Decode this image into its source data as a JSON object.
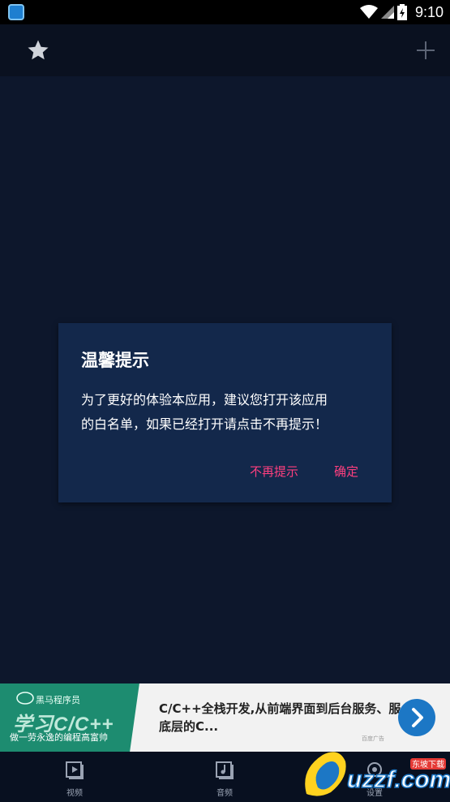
{
  "status_bar": {
    "time": "9:10"
  },
  "dialog": {
    "title": "温馨提示",
    "message_line1": "为了更好的体验本应用，建议您打开该应用",
    "message_line2": "的白名单，如果已经打开请点击不再提示！",
    "dont_remind_label": "不再提示",
    "ok_label": "确定"
  },
  "ad": {
    "brand": "黑马程序员",
    "headline_image_text": "学习C/C++",
    "slogan": "做一劳永逸的编程高富帅",
    "text_line1": "C/C++全栈开发,从前端界面到后台服务、服",
    "text_line2": "底层的C...",
    "tag": "百度广告"
  },
  "bottom_nav": {
    "items": [
      {
        "label": "视频",
        "icon": "video-icon"
      },
      {
        "label": "音频",
        "icon": "audio-icon"
      },
      {
        "label": "设置",
        "icon": "settings-icon"
      }
    ]
  },
  "watermark": {
    "brand": "uzzf.com",
    "caption": "东坡下载"
  },
  "colors": {
    "background": "#0d172c",
    "dialog": "#13284b",
    "accent": "#ff3f7f",
    "ad_button": "#1c77c5"
  }
}
